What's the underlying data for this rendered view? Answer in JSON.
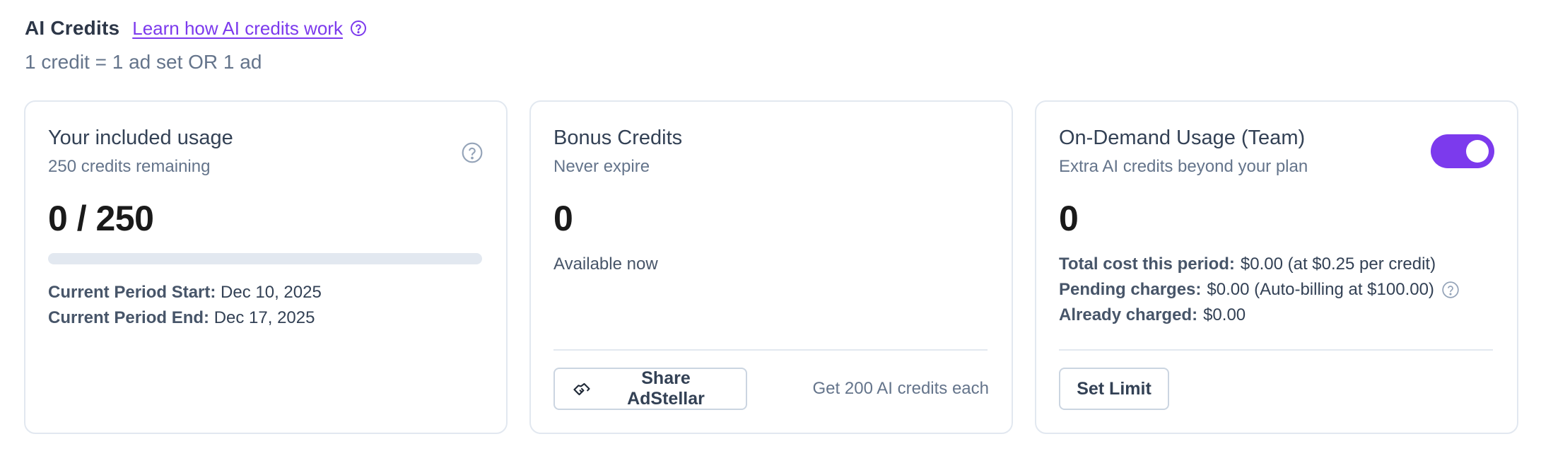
{
  "header": {
    "title": "AI Credits",
    "link_text": "Learn how AI credits work",
    "help_icon": "question-circle-icon",
    "subtitle": "1 credit = 1 ad set OR 1 ad"
  },
  "included": {
    "title": "Your included usage",
    "subtitle": "250 credits remaining",
    "usage": "0 / 250",
    "progress_fraction": 0,
    "period_start_label": "Current Period Start:",
    "period_start_value": "Dec 10, 2025",
    "period_end_label": "Current Period End:",
    "period_end_value": "Dec 17, 2025",
    "help_icon": "question-circle-icon"
  },
  "bonus": {
    "title": "Bonus Credits",
    "subtitle": "Never expire",
    "value": "0",
    "available": "Available now",
    "share_button": "Share AdStellar",
    "share_icon": "handshake-icon",
    "get_credits": "Get 200 AI credits each"
  },
  "ondemand": {
    "title": "On-Demand Usage (Team)",
    "subtitle": "Extra AI credits beyond your plan",
    "toggle_on": true,
    "value": "0",
    "total_label": "Total cost this period:",
    "total_value": "$0.00 (at $0.25 per credit)",
    "pending_label": "Pending charges:",
    "pending_value": "$0.00 (Auto-billing at $100.00)",
    "charged_label": "Already charged:",
    "charged_value": "$0.00",
    "set_limit_button": "Set Limit",
    "help_icon": "question-circle-icon"
  },
  "colors": {
    "accent": "#7c3aed",
    "border": "#e2e8f0",
    "muted_text": "#64748b"
  }
}
